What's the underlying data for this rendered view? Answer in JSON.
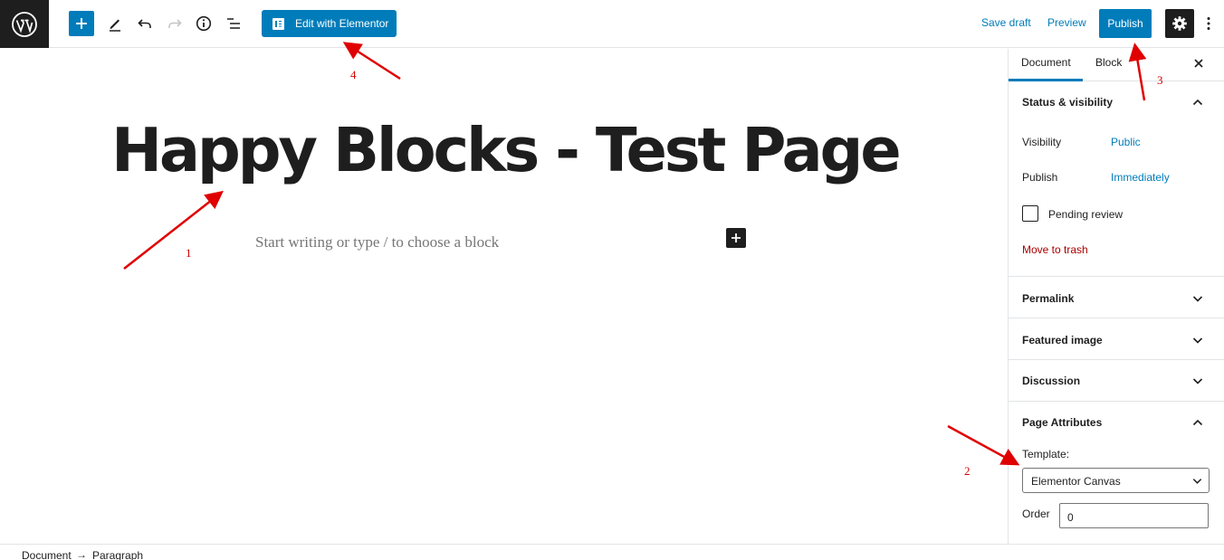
{
  "toolbar": {
    "edit_with_elementor": "Edit with Elementor",
    "save_draft": "Save draft",
    "preview": "Preview",
    "publish": "Publish"
  },
  "editor": {
    "title": "Happy Blocks - Test Page",
    "placeholder": "Start writing or type / to choose a block"
  },
  "sidebar": {
    "tabs": [
      "Document",
      "Block"
    ],
    "active_tab": "Document",
    "status_visibility": {
      "heading": "Status & visibility",
      "visibility_label": "Visibility",
      "visibility_value": "Public",
      "publish_label": "Publish",
      "publish_value": "Immediately",
      "pending_review": "Pending review",
      "move_to_trash": "Move to trash"
    },
    "panels": {
      "permalink": "Permalink",
      "featured_image": "Featured image",
      "discussion": "Discussion",
      "page_attributes": "Page Attributes"
    },
    "page_attributes": {
      "template_label": "Template:",
      "template_value": "Elementor Canvas",
      "order_label": "Order",
      "order_value": "0"
    }
  },
  "footer": {
    "breadcrumb": [
      "Document",
      "Paragraph"
    ],
    "separator": "→"
  },
  "annotations": [
    "1",
    "2",
    "3",
    "4"
  ],
  "colors": {
    "accent": "#007cba",
    "dark": "#1e1e1e",
    "annotation": "#e00000",
    "trash": "#aa0000"
  }
}
